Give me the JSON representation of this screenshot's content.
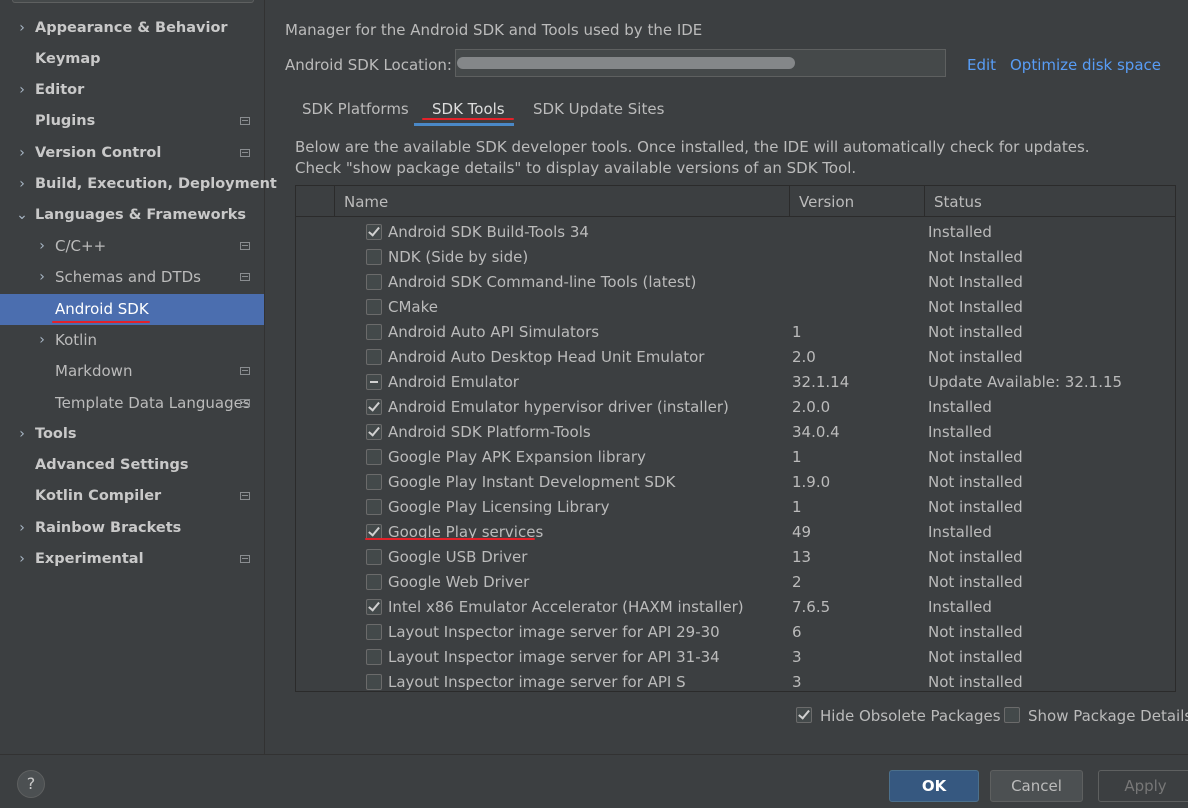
{
  "sidebar": {
    "items": [
      {
        "label": "Appearance & Behavior",
        "arrow": "›",
        "bold": true,
        "badge": false
      },
      {
        "label": "Keymap",
        "arrow": "",
        "bold": true,
        "badge": false
      },
      {
        "label": "Editor",
        "arrow": "›",
        "bold": true,
        "badge": false
      },
      {
        "label": "Plugins",
        "arrow": "",
        "bold": true,
        "badge": true
      },
      {
        "label": "Version Control",
        "arrow": "›",
        "bold": true,
        "badge": true
      },
      {
        "label": "Build, Execution, Deployment",
        "arrow": "›",
        "bold": true,
        "badge": false
      },
      {
        "label": "Languages & Frameworks",
        "arrow": "⌄",
        "bold": true,
        "badge": false
      },
      {
        "label": "C/C++",
        "arrow": "›",
        "bold": false,
        "badge": true
      },
      {
        "label": "Schemas and DTDs",
        "arrow": "›",
        "bold": false,
        "badge": true
      },
      {
        "label": "Android SDK",
        "arrow": "",
        "bold": false,
        "badge": false,
        "selected": true
      },
      {
        "label": "Kotlin",
        "arrow": "›",
        "bold": false,
        "badge": false
      },
      {
        "label": "Markdown",
        "arrow": "",
        "bold": false,
        "badge": true
      },
      {
        "label": "Template Data Languages",
        "arrow": "",
        "bold": false,
        "badge": true
      },
      {
        "label": "Tools",
        "arrow": "›",
        "bold": true,
        "badge": false
      },
      {
        "label": "Advanced Settings",
        "arrow": "",
        "bold": true,
        "badge": false
      },
      {
        "label": "Kotlin Compiler",
        "arrow": "",
        "bold": true,
        "badge": true
      },
      {
        "label": "Rainbow Brackets",
        "arrow": "›",
        "bold": true,
        "badge": false
      },
      {
        "label": "Experimental",
        "arrow": "›",
        "bold": true,
        "badge": true
      }
    ]
  },
  "main": {
    "header": "Manager for the Android SDK and Tools used by the IDE",
    "location_label": "Android SDK Location:",
    "edit_link": "Edit",
    "optimize_link": "Optimize disk space",
    "tabs": [
      "SDK Platforms",
      "SDK Tools",
      "SDK Update Sites"
    ],
    "active_tab": "SDK Tools",
    "description_line1": "Below are the available SDK developer tools. Once installed, the IDE will automatically check for updates.",
    "description_line2": "Check \"show package details\" to display available versions of an SDK Tool.",
    "table": {
      "columns": [
        "Name",
        "Version",
        "Status"
      ],
      "rows": [
        {
          "state": "checked",
          "name": "Android SDK Build-Tools 34",
          "version": "",
          "status": "Installed"
        },
        {
          "state": "unchecked",
          "name": "NDK (Side by side)",
          "version": "",
          "status": "Not Installed"
        },
        {
          "state": "unchecked",
          "name": "Android SDK Command-line Tools (latest)",
          "version": "",
          "status": "Not Installed"
        },
        {
          "state": "unchecked",
          "name": "CMake",
          "version": "",
          "status": "Not Installed"
        },
        {
          "state": "unchecked",
          "name": "Android Auto API Simulators",
          "version": "1",
          "status": "Not installed"
        },
        {
          "state": "unchecked",
          "name": "Android Auto Desktop Head Unit Emulator",
          "version": "2.0",
          "status": "Not installed"
        },
        {
          "state": "partial",
          "name": "Android Emulator",
          "version": "32.1.14",
          "status": "Update Available: 32.1.15"
        },
        {
          "state": "checked",
          "name": "Android Emulator hypervisor driver (installer)",
          "version": "2.0.0",
          "status": "Installed"
        },
        {
          "state": "checked",
          "name": "Android SDK Platform-Tools",
          "version": "34.0.4",
          "status": "Installed"
        },
        {
          "state": "unchecked",
          "name": "Google Play APK Expansion library",
          "version": "1",
          "status": "Not installed"
        },
        {
          "state": "unchecked",
          "name": "Google Play Instant Development SDK",
          "version": "1.9.0",
          "status": "Not installed"
        },
        {
          "state": "unchecked",
          "name": "Google Play Licensing Library",
          "version": "1",
          "status": "Not installed"
        },
        {
          "state": "checked",
          "name": "Google Play services",
          "version": "49",
          "status": "Installed"
        },
        {
          "state": "unchecked",
          "name": "Google USB Driver",
          "version": "13",
          "status": "Not installed"
        },
        {
          "state": "unchecked",
          "name": "Google Web Driver",
          "version": "2",
          "status": "Not installed"
        },
        {
          "state": "checked",
          "name": "Intel x86 Emulator Accelerator (HAXM installer)",
          "version": "7.6.5",
          "status": "Installed"
        },
        {
          "state": "unchecked",
          "name": "Layout Inspector image server for API 29-30",
          "version": "6",
          "status": "Not installed"
        },
        {
          "state": "unchecked",
          "name": "Layout Inspector image server for API 31-34",
          "version": "3",
          "status": "Not installed"
        },
        {
          "state": "unchecked",
          "name": "Layout Inspector image server for API S",
          "version": "3",
          "status": "Not installed"
        }
      ]
    },
    "hide_obsolete_label": "Hide Obsolete Packages",
    "hide_obsolete_checked": true,
    "show_details_label": "Show Package Details",
    "show_details_checked": false
  },
  "footer": {
    "help_label": "?",
    "ok_label": "OK",
    "cancel_label": "Cancel",
    "apply_label": "Apply"
  },
  "colors": {
    "background": "#3c3f41",
    "selection": "#4b6eaf",
    "link": "#589df6",
    "annotation_red": "#e3222a",
    "ok_button": "#365880"
  }
}
